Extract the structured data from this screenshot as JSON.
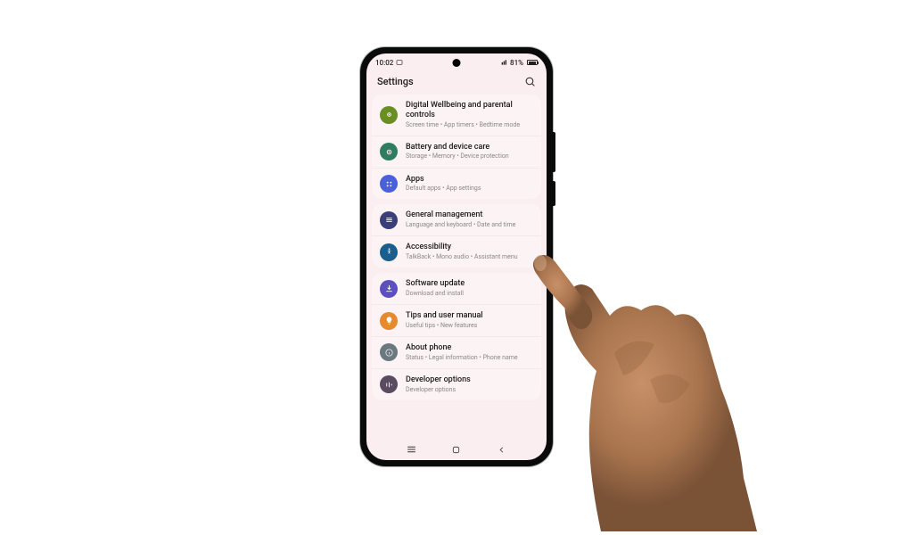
{
  "status": {
    "time": "10:02",
    "battery_text": "81%"
  },
  "header": {
    "title": "Settings"
  },
  "groups": [
    {
      "items": [
        {
          "icon_color": "#6b8e23",
          "icon_name": "wellbeing-icon",
          "title": "Digital Wellbeing and parental controls",
          "subtitle": "Screen time  •  App timers  •  Bedtime mode"
        },
        {
          "icon_color": "#2e7d5e",
          "icon_name": "battery-care-icon",
          "title": "Battery and device care",
          "subtitle": "Storage  •  Memory  •  Device protection"
        },
        {
          "icon_color": "#4a5fd8",
          "icon_name": "apps-icon",
          "title": "Apps",
          "subtitle": "Default apps  •  App settings"
        }
      ]
    },
    {
      "items": [
        {
          "icon_color": "#3b3f78",
          "icon_name": "general-management-icon",
          "title": "General management",
          "subtitle": "Language and keyboard  •  Date and time"
        },
        {
          "icon_color": "#1a5e8e",
          "icon_name": "accessibility-icon",
          "title": "Accessibility",
          "subtitle": "TalkBack  •  Mono audio  •  Assistant menu"
        }
      ]
    },
    {
      "items": [
        {
          "icon_color": "#5b4fc2",
          "icon_name": "software-update-icon",
          "title": "Software update",
          "subtitle": "Download and install"
        },
        {
          "icon_color": "#e68a2e",
          "icon_name": "tips-icon",
          "title": "Tips and user manual",
          "subtitle": "Useful tips  •  New features"
        },
        {
          "icon_color": "#6b7880",
          "icon_name": "about-phone-icon",
          "title": "About phone",
          "subtitle": "Status  •  Legal information  •  Phone name"
        },
        {
          "icon_color": "#5a4a62",
          "icon_name": "developer-options-icon",
          "title": "Developer options",
          "subtitle": "Developer options"
        }
      ]
    }
  ]
}
